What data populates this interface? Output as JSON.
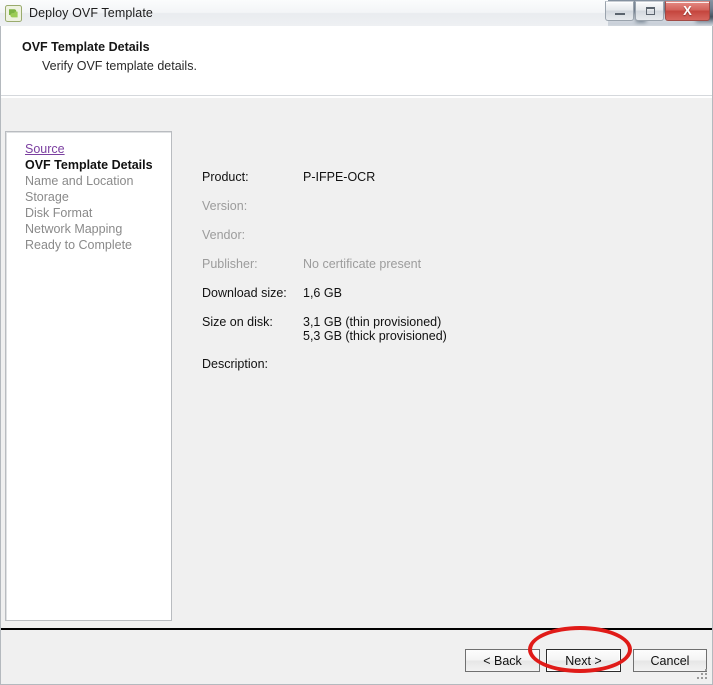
{
  "window": {
    "title": "Deploy OVF Template",
    "icon": "ovf-template-icon",
    "controls": {
      "minimize_label": "—",
      "maximize_label": "□",
      "close_label": "X"
    }
  },
  "header": {
    "title": "OVF Template Details",
    "subtitle": "Verify OVF template details."
  },
  "sidebar": {
    "items": [
      {
        "label": "Source",
        "state": "visited-link"
      },
      {
        "label": "OVF Template Details",
        "state": "active"
      },
      {
        "label": "Name and Location",
        "state": "disabled"
      },
      {
        "label": "Storage",
        "state": "disabled"
      },
      {
        "label": "Disk Format",
        "state": "disabled"
      },
      {
        "label": "Network Mapping",
        "state": "disabled"
      },
      {
        "label": "Ready to Complete",
        "state": "disabled"
      }
    ]
  },
  "details": {
    "product": {
      "label": "Product:",
      "value": "P-IFPE-OCR",
      "dim": false
    },
    "version": {
      "label": "Version:",
      "value": "",
      "dim": true
    },
    "vendor": {
      "label": "Vendor:",
      "value": "",
      "dim": true
    },
    "publisher": {
      "label": "Publisher:",
      "value": "No certificate present",
      "dim": true
    },
    "download_size": {
      "label": "Download size:",
      "value": "1,6 GB",
      "dim": false
    },
    "size_on_disk": {
      "label": "Size on disk:",
      "value_line1": "3,1 GB (thin provisioned)",
      "value_line2": "5,3 GB (thick provisioned)",
      "dim": false
    },
    "description": {
      "label": "Description:",
      "value": "",
      "dim": false
    }
  },
  "footer": {
    "back_label": "< Back",
    "next_label": "Next >",
    "cancel_label": "Cancel"
  },
  "annotation": {
    "type": "red-ellipse-highlight",
    "target": "next-button",
    "color": "#e01b18"
  },
  "colors": {
    "panel_bg": "#f0f0f0",
    "white": "#ffffff",
    "link_purple": "#7b3fa0",
    "disabled_text": "#8a8a8a",
    "accent_red": "#e01b18",
    "close_red": "#c4453d"
  }
}
